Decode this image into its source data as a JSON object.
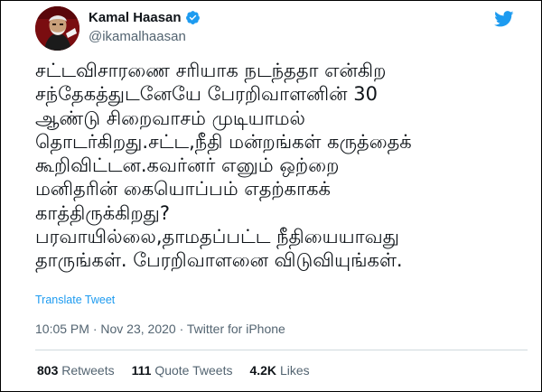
{
  "user": {
    "display_name": "Kamal Haasan",
    "handle": "@ikamalhaasan",
    "verified": true,
    "verified_icon": "verified-badge-icon",
    "avatar_icon": "profile-photo-avatar"
  },
  "platform_icon": "twitter-bird-icon",
  "tweet": {
    "lines": [
      "சட்டவிசாரணை சரியாக நடந்ததா என்கிற",
      "சந்தேகத்துடனேயே பேரறிவாளனின் 30",
      "ஆண்டு சிறைவாசம் முடியாமல்",
      "தொடர்கிறது.சட்ட,நீதி மன்றங்கள் கருத்தைக்",
      "கூறிவிட்டன.கவர்னர் எனும் ஒற்றை",
      "மனிதரின் கையொப்பம் எதற்காகக்",
      "காத்திருக்கிறது?",
      "பரவாயில்லை,தாமதப்பட்ட நீதியையாவது",
      "தாருங்கள். பேரறிவாளனை விடுவியுங்கள்."
    ]
  },
  "translate_label": "Translate Tweet",
  "meta": {
    "time": "10:05 PM",
    "separator": "·",
    "date": "Nov 23, 2020",
    "source": "Twitter for iPhone"
  },
  "stats": {
    "retweets_count": "803",
    "retweets_label": "Retweets",
    "quotes_count": "111",
    "quotes_label": "Quote Tweets",
    "likes_count": "4.2K",
    "likes_label": "Likes"
  },
  "colors": {
    "link_blue": "#1d9bf0",
    "text_primary": "#0f1419",
    "text_secondary": "#536471",
    "divider": "#cfd9de"
  }
}
